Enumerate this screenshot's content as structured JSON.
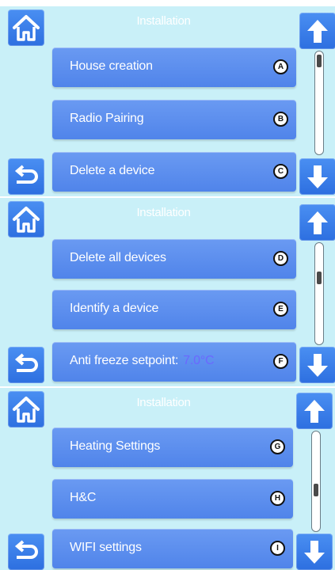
{
  "colors": {
    "panel_bg": "#c9f0f8",
    "button": "#3a7ee8",
    "menu_item": "#5c8fee",
    "value_text": "#6b68ff"
  },
  "icons": {
    "home": "home-icon",
    "back": "back-arrow-icon",
    "up": "arrow-up-icon",
    "down": "arrow-down-icon"
  },
  "screens": [
    {
      "title": "Installation",
      "scroll_position": 0.0,
      "items": [
        {
          "label": "House creation",
          "badge": "A"
        },
        {
          "label": "Radio Pairing",
          "badge": "B"
        },
        {
          "label": "Delete a device",
          "badge": "C"
        }
      ]
    },
    {
      "title": "Installation",
      "scroll_position": 0.5,
      "items": [
        {
          "label": "Delete all devices",
          "badge": "D"
        },
        {
          "label": "Identify a device",
          "badge": "E"
        },
        {
          "label": "Anti freeze setpoint:",
          "value": "7.0°C",
          "badge": "F"
        }
      ]
    },
    {
      "title": "Installation",
      "scroll_position": 0.62,
      "items": [
        {
          "label": "Heating Settings",
          "badge": "G"
        },
        {
          "label": "H&C",
          "badge": "H"
        },
        {
          "label": "WIFI settings",
          "badge": "I"
        }
      ]
    }
  ]
}
